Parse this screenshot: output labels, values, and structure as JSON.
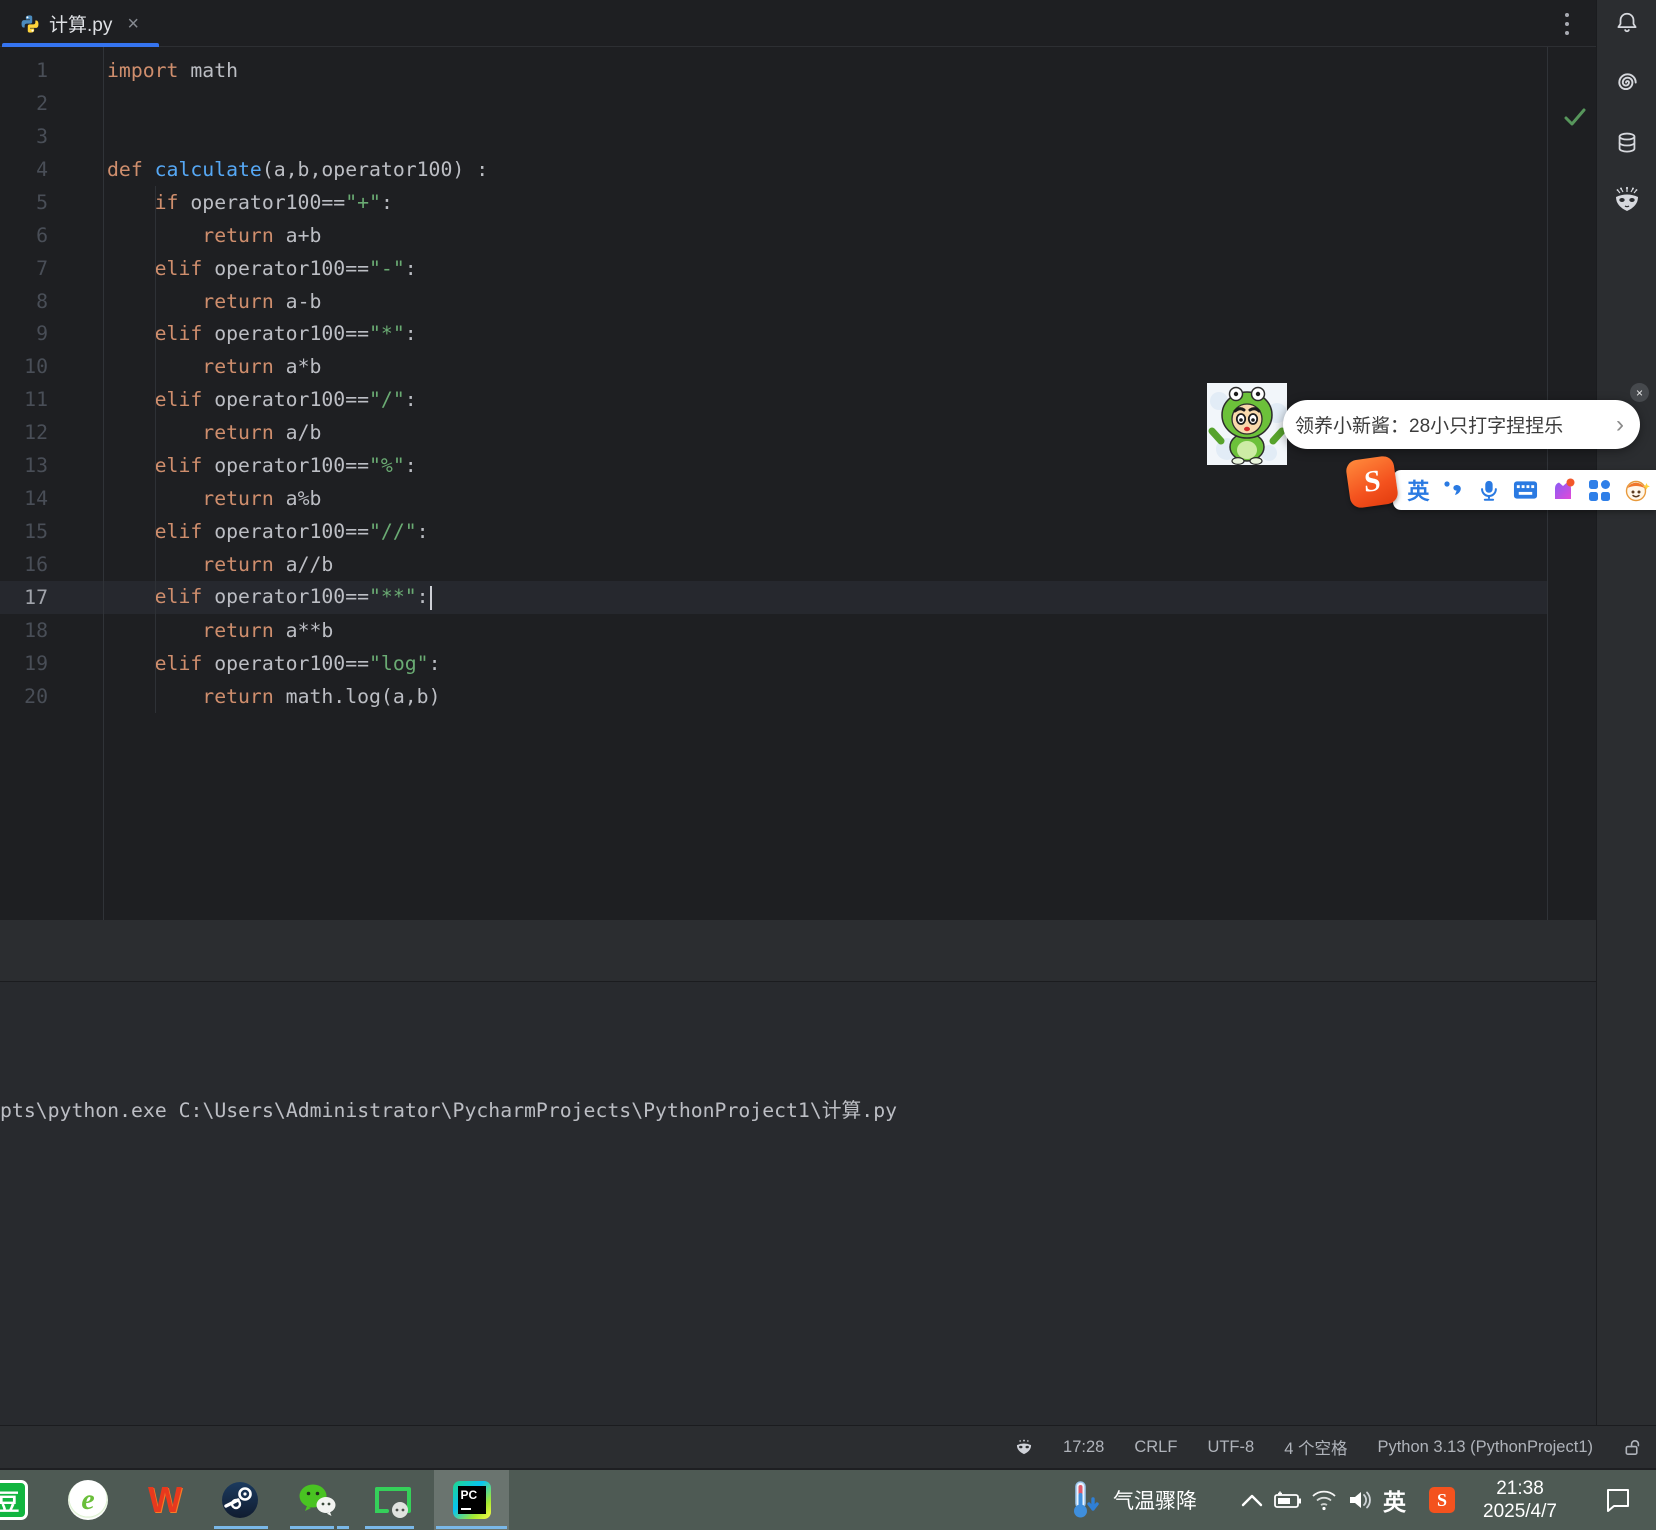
{
  "tab_bar": {
    "tab_title": "计算.py",
    "close_glyph": "×"
  },
  "editor": {
    "current_line": 17,
    "lines": [
      {
        "n": "1",
        "tokens": [
          {
            "c": "k",
            "t": "import"
          },
          {
            "c": "p",
            "t": " math"
          }
        ]
      },
      {
        "n": "2",
        "tokens": []
      },
      {
        "n": "3",
        "tokens": []
      },
      {
        "n": "4",
        "tokens": [
          {
            "c": "k",
            "t": "def "
          },
          {
            "c": "f",
            "t": "calculate"
          },
          {
            "c": "p",
            "t": "(a,b,operator100) :"
          }
        ]
      },
      {
        "n": "5",
        "tokens": [
          {
            "c": "p",
            "t": "    "
          },
          {
            "c": "k",
            "t": "if "
          },
          {
            "c": "p",
            "t": "operator100=="
          },
          {
            "c": "s",
            "t": "\"+\""
          },
          {
            "c": "p",
            "t": ":"
          }
        ]
      },
      {
        "n": "6",
        "tokens": [
          {
            "c": "p",
            "t": "        "
          },
          {
            "c": "k",
            "t": "return "
          },
          {
            "c": "p",
            "t": "a+b"
          }
        ]
      },
      {
        "n": "7",
        "tokens": [
          {
            "c": "p",
            "t": "    "
          },
          {
            "c": "k",
            "t": "elif "
          },
          {
            "c": "p",
            "t": "operator100=="
          },
          {
            "c": "s",
            "t": "\"-\""
          },
          {
            "c": "p",
            "t": ":"
          }
        ]
      },
      {
        "n": "8",
        "tokens": [
          {
            "c": "p",
            "t": "        "
          },
          {
            "c": "k",
            "t": "return "
          },
          {
            "c": "p",
            "t": "a-b"
          }
        ]
      },
      {
        "n": "9",
        "tokens": [
          {
            "c": "p",
            "t": "    "
          },
          {
            "c": "k",
            "t": "elif "
          },
          {
            "c": "p",
            "t": "operator100=="
          },
          {
            "c": "s",
            "t": "\"*\""
          },
          {
            "c": "p",
            "t": ":"
          }
        ]
      },
      {
        "n": "10",
        "tokens": [
          {
            "c": "p",
            "t": "        "
          },
          {
            "c": "k",
            "t": "return "
          },
          {
            "c": "p",
            "t": "a*b"
          }
        ]
      },
      {
        "n": "11",
        "tokens": [
          {
            "c": "p",
            "t": "    "
          },
          {
            "c": "k",
            "t": "elif "
          },
          {
            "c": "p",
            "t": "operator100=="
          },
          {
            "c": "s",
            "t": "\"/\""
          },
          {
            "c": "p",
            "t": ":"
          }
        ]
      },
      {
        "n": "12",
        "tokens": [
          {
            "c": "p",
            "t": "        "
          },
          {
            "c": "k",
            "t": "return "
          },
          {
            "c": "p",
            "t": "a/b"
          }
        ]
      },
      {
        "n": "13",
        "tokens": [
          {
            "c": "p",
            "t": "    "
          },
          {
            "c": "k",
            "t": "elif "
          },
          {
            "c": "p",
            "t": "operator100=="
          },
          {
            "c": "s",
            "t": "\"%\""
          },
          {
            "c": "p",
            "t": ":"
          }
        ]
      },
      {
        "n": "14",
        "tokens": [
          {
            "c": "p",
            "t": "        "
          },
          {
            "c": "k",
            "t": "return "
          },
          {
            "c": "p",
            "t": "a%b"
          }
        ]
      },
      {
        "n": "15",
        "tokens": [
          {
            "c": "p",
            "t": "    "
          },
          {
            "c": "k",
            "t": "elif "
          },
          {
            "c": "p",
            "t": "operator100=="
          },
          {
            "c": "s",
            "t": "\"//\""
          },
          {
            "c": "p",
            "t": ":"
          }
        ]
      },
      {
        "n": "16",
        "tokens": [
          {
            "c": "p",
            "t": "        "
          },
          {
            "c": "k",
            "t": "return "
          },
          {
            "c": "p",
            "t": "a//b"
          }
        ]
      },
      {
        "n": "17",
        "current": true,
        "cursor": true,
        "tokens": [
          {
            "c": "p",
            "t": "    "
          },
          {
            "c": "k",
            "t": "elif "
          },
          {
            "c": "p",
            "t": "operator100=="
          },
          {
            "c": "s",
            "t": "\"**\""
          },
          {
            "c": "p",
            "t": ":"
          }
        ]
      },
      {
        "n": "18",
        "tokens": [
          {
            "c": "p",
            "t": "        "
          },
          {
            "c": "k",
            "t": "return "
          },
          {
            "c": "p",
            "t": "a**b"
          }
        ]
      },
      {
        "n": "19",
        "tokens": [
          {
            "c": "p",
            "t": "    "
          },
          {
            "c": "k",
            "t": "elif "
          },
          {
            "c": "p",
            "t": "operator100=="
          },
          {
            "c": "s",
            "t": "\"log\""
          },
          {
            "c": "p",
            "t": ":"
          }
        ]
      },
      {
        "n": "20",
        "tokens": [
          {
            "c": "p",
            "t": "        "
          },
          {
            "c": "k",
            "t": "return "
          },
          {
            "c": "p",
            "t": "math.log(a,b)"
          }
        ]
      }
    ]
  },
  "console": {
    "line": "pts\\python.exe C:\\Users\\Administrator\\PycharmProjects\\PythonProject1\\计算.py"
  },
  "status_bar": {
    "time": "17:28",
    "line_separator": "CRLF",
    "encoding": "UTF-8",
    "indent": "4 个空格",
    "interpreter": "Python 3.13 (PythonProject1)"
  },
  "popup": {
    "message": "领养小新酱：28小只打字捏捏乐",
    "chevron": "›",
    "close_glyph": "×"
  },
  "sogou": {
    "mode_label": "英",
    "logo_letter": "S"
  },
  "taskbar": {
    "douban_glyph": "豆",
    "wps_glyph": "W",
    "pycharm_label": "PC",
    "weather_text": "气温骤降",
    "lang_indicator": "英",
    "ime_letter": "S",
    "clock_time": "21:38",
    "clock_date": "2025/4/7"
  },
  "colors": {
    "editor_bg": "#1e1f22",
    "panel_bg": "#2b2d30",
    "accent_tab_blue": "#3574f0",
    "keyword": "#cf8e6d",
    "function_name": "#56a8f5",
    "string": "#6aab73",
    "plain_text": "#bcbec4",
    "check_green": "#57965c",
    "taskbar_green": "#4e5a54",
    "sogou_orange": "#f4521e",
    "taskbar_underline": "#7ab8e8"
  }
}
